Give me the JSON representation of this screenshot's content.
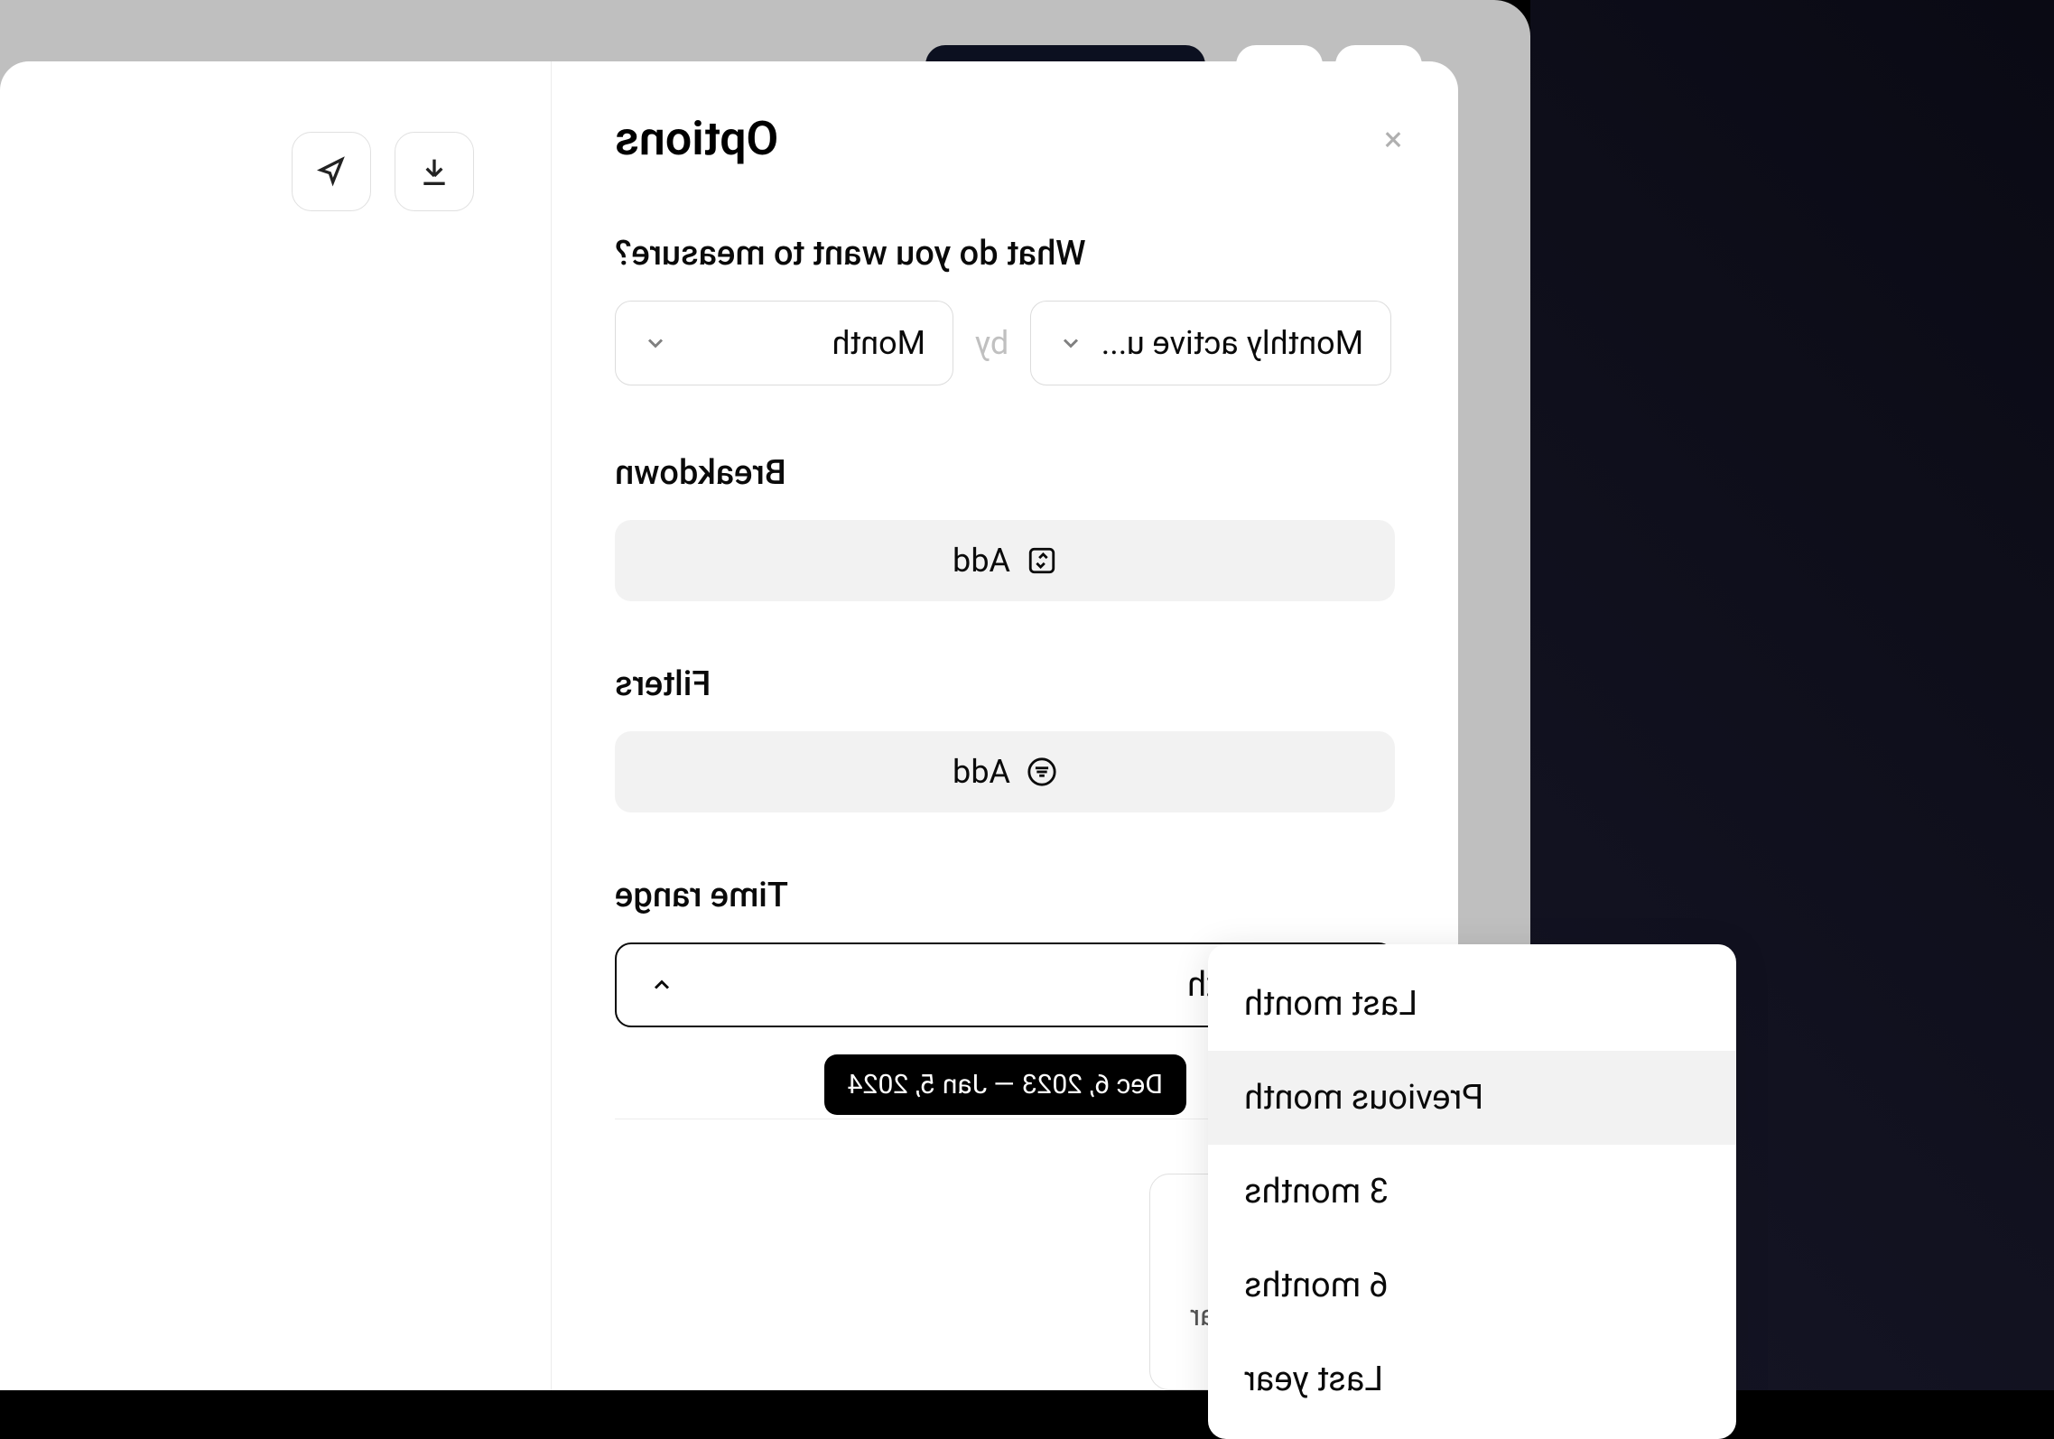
{
  "panel": {
    "title": "Options",
    "close": "×"
  },
  "measure": {
    "question": "What do you want to measure?",
    "metric": "Monthly active u...",
    "conjunction": "by",
    "period": "Month"
  },
  "breakdown": {
    "label": "Breakdown",
    "add": "Add"
  },
  "filters": {
    "label": "Filters",
    "add": "Add"
  },
  "timerange": {
    "label": "Time range",
    "selected": "Last month",
    "options": {
      "last_month": "Last month",
      "previous_month": "Previous month",
      "three_months": "3 months",
      "six_months": "6 months",
      "last_year": "Last year"
    },
    "tooltip": "Dec 6, 2023 — Jan 5, 2024"
  },
  "display": {
    "progress_bar": "Progress bar"
  }
}
